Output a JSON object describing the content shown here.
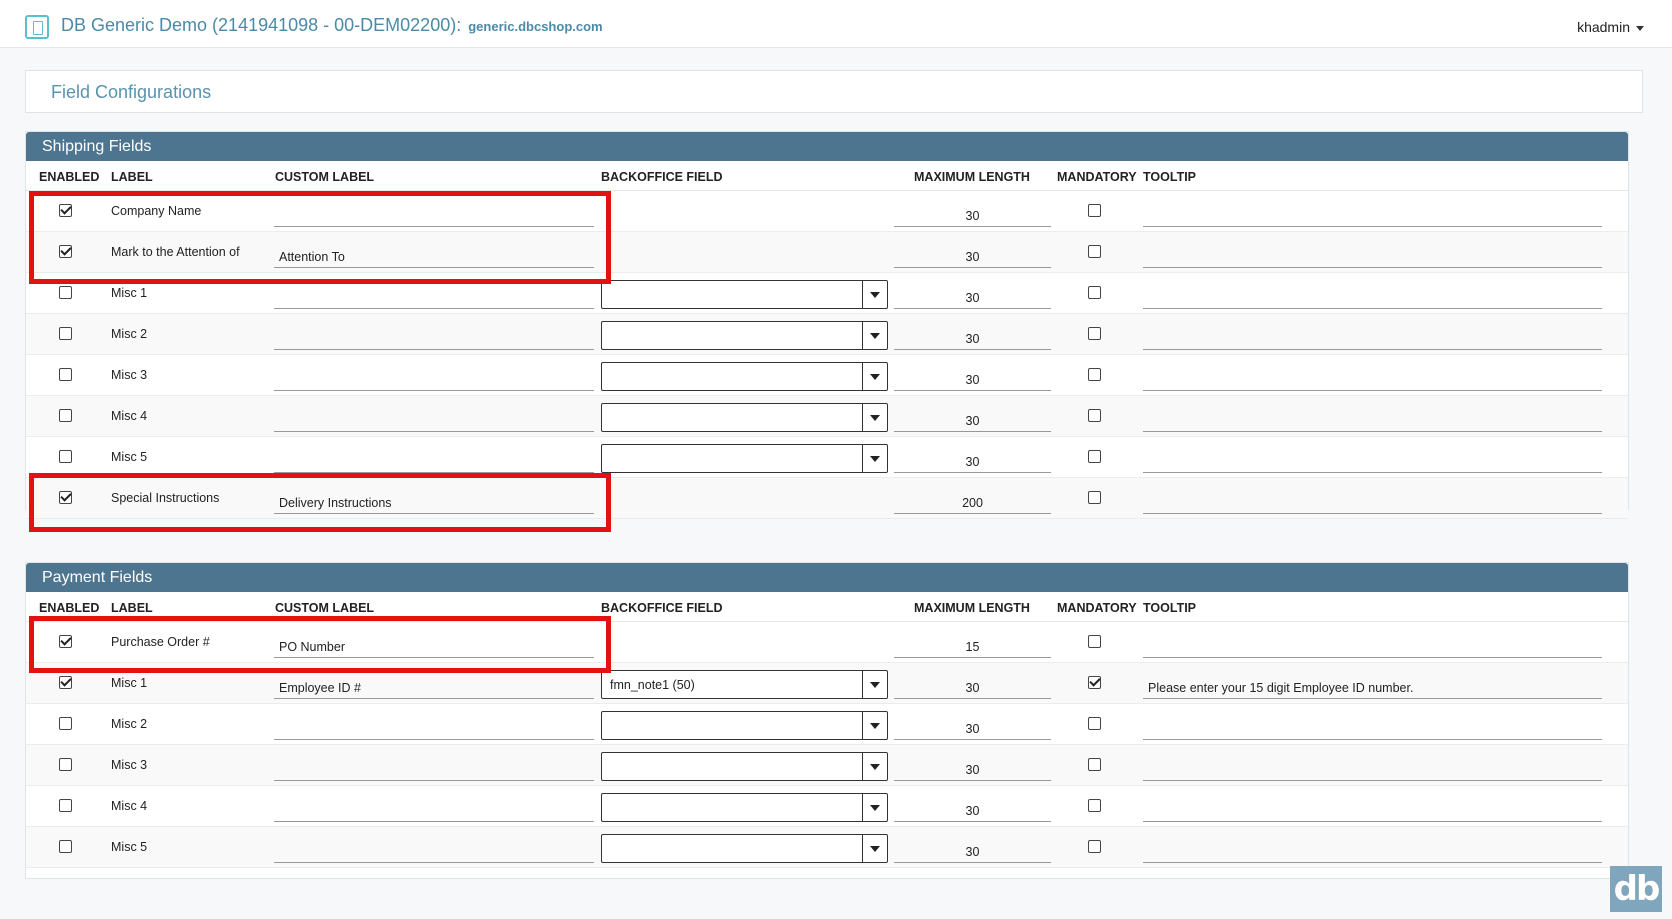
{
  "header": {
    "app_title": "DB Generic Demo (2141941098 - 00-DEM02200):",
    "domain": "generic.dbcshop.com",
    "user": "khadmin"
  },
  "page_title": "Field Configurations",
  "columns": {
    "enabled": "ENABLED",
    "label": "LABEL",
    "custom_label": "CUSTOM LABEL",
    "backoffice_field": "BACKOFFICE FIELD",
    "max_length": "MAXIMUM LENGTH",
    "mandatory": "MANDATORY",
    "tooltip": "TOOLTIP"
  },
  "shipping": {
    "title": "Shipping Fields",
    "rows": [
      {
        "enabled": true,
        "label": "Company Name",
        "custom_label": "",
        "has_select": false,
        "backoffice": "",
        "max_length": "30",
        "mandatory": false,
        "tooltip": ""
      },
      {
        "enabled": true,
        "label": "Mark to the Attention of",
        "custom_label": "Attention To",
        "has_select": false,
        "backoffice": "",
        "max_length": "30",
        "mandatory": false,
        "tooltip": ""
      },
      {
        "enabled": false,
        "label": "Misc 1",
        "custom_label": "",
        "has_select": true,
        "backoffice": "",
        "max_length": "30",
        "mandatory": false,
        "tooltip": ""
      },
      {
        "enabled": false,
        "label": "Misc 2",
        "custom_label": "",
        "has_select": true,
        "backoffice": "",
        "max_length": "30",
        "mandatory": false,
        "tooltip": ""
      },
      {
        "enabled": false,
        "label": "Misc 3",
        "custom_label": "",
        "has_select": true,
        "backoffice": "",
        "max_length": "30",
        "mandatory": false,
        "tooltip": ""
      },
      {
        "enabled": false,
        "label": "Misc 4",
        "custom_label": "",
        "has_select": true,
        "backoffice": "",
        "max_length": "30",
        "mandatory": false,
        "tooltip": ""
      },
      {
        "enabled": false,
        "label": "Misc 5",
        "custom_label": "",
        "has_select": true,
        "backoffice": "",
        "max_length": "30",
        "mandatory": false,
        "tooltip": ""
      },
      {
        "enabled": true,
        "label": "Special Instructions",
        "custom_label": "Delivery Instructions",
        "has_select": false,
        "backoffice": "",
        "max_length": "200",
        "mandatory": false,
        "tooltip": ""
      }
    ]
  },
  "payment": {
    "title": "Payment Fields",
    "rows": [
      {
        "enabled": true,
        "label": "Purchase Order #",
        "custom_label": "PO Number",
        "has_select": false,
        "backoffice": "",
        "max_length": "15",
        "mandatory": false,
        "tooltip": ""
      },
      {
        "enabled": true,
        "label": "Misc 1",
        "custom_label": "Employee ID #",
        "has_select": true,
        "backoffice": "fmn_note1 (50)",
        "max_length": "30",
        "mandatory": true,
        "tooltip": "Please enter your 15 digit Employee ID number."
      },
      {
        "enabled": false,
        "label": "Misc 2",
        "custom_label": "",
        "has_select": true,
        "backoffice": "",
        "max_length": "30",
        "mandatory": false,
        "tooltip": ""
      },
      {
        "enabled": false,
        "label": "Misc 3",
        "custom_label": "",
        "has_select": true,
        "backoffice": "",
        "max_length": "30",
        "mandatory": false,
        "tooltip": ""
      },
      {
        "enabled": false,
        "label": "Misc 4",
        "custom_label": "",
        "has_select": true,
        "backoffice": "",
        "max_length": "30",
        "mandatory": false,
        "tooltip": ""
      },
      {
        "enabled": false,
        "label": "Misc 5",
        "custom_label": "",
        "has_select": true,
        "backoffice": "",
        "max_length": "30",
        "mandatory": false,
        "tooltip": ""
      }
    ]
  },
  "logo_text": "db",
  "colors": {
    "panel_header": "#4e7590",
    "accent": "#4b8aa6",
    "highlight": "#e31212"
  }
}
